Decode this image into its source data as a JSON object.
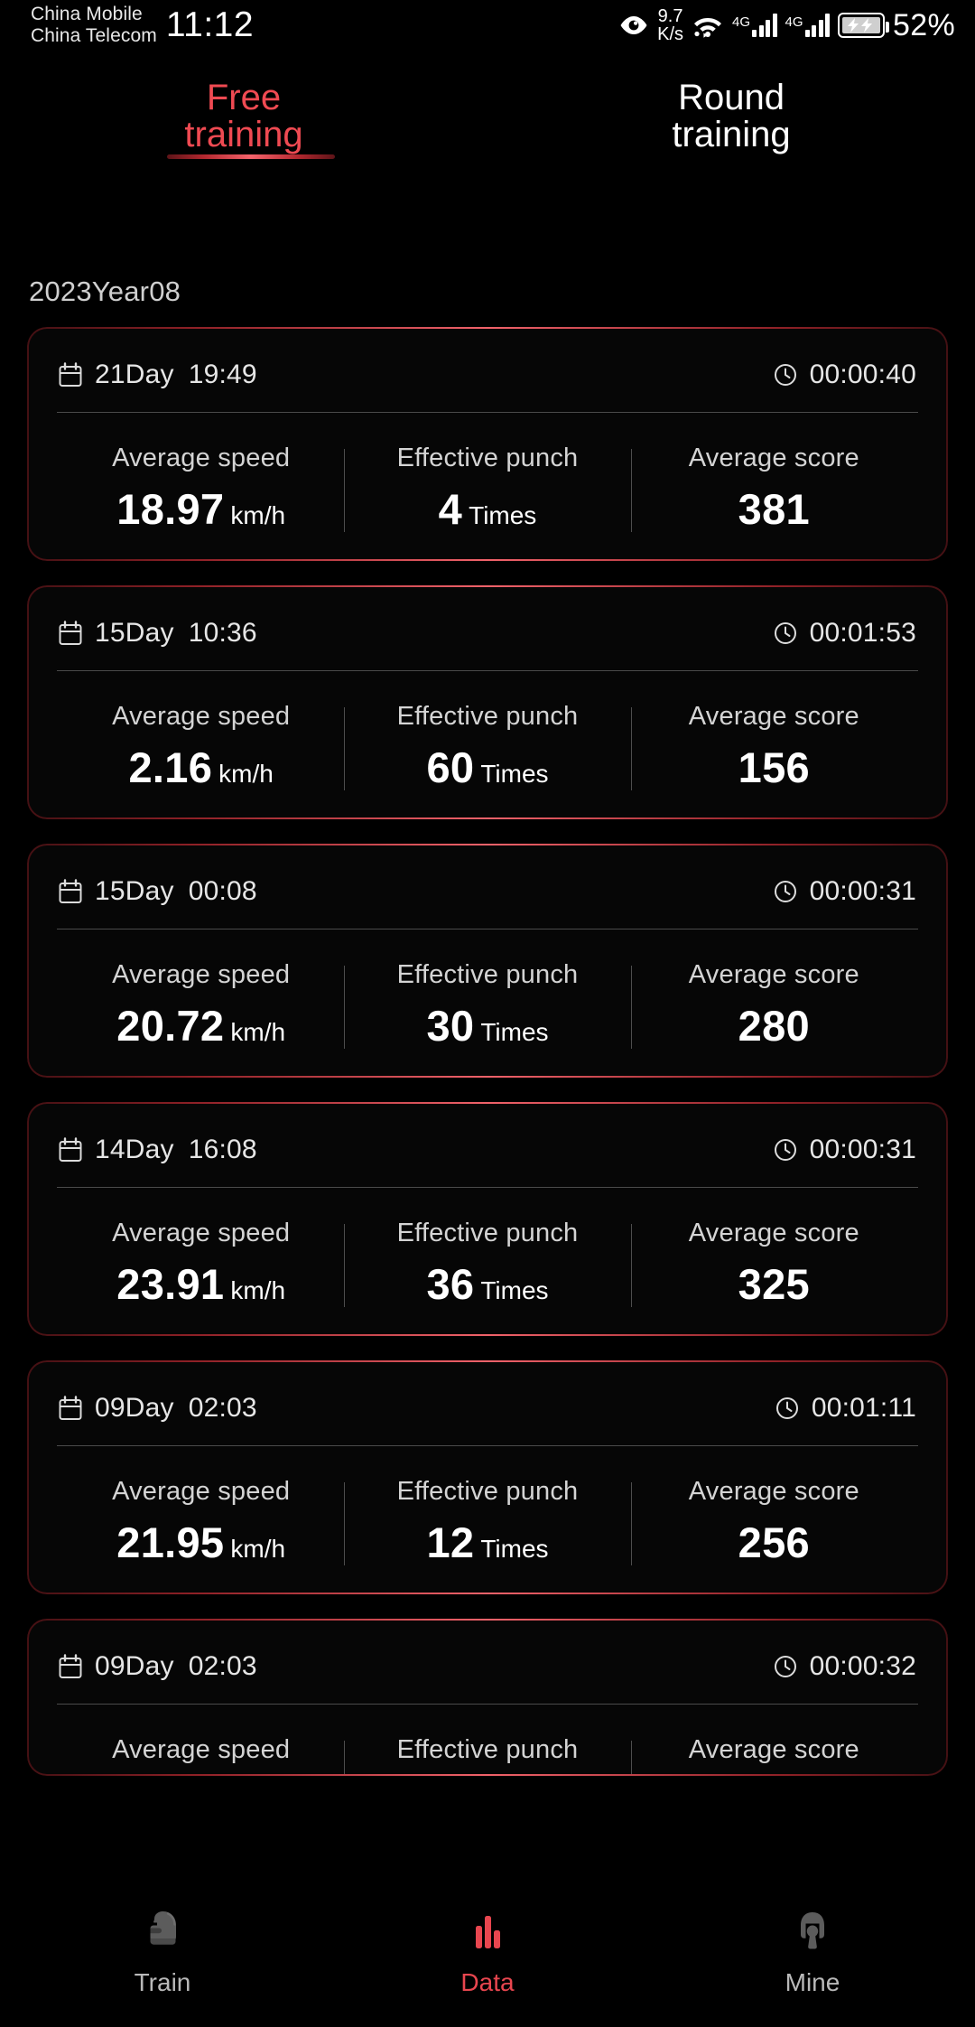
{
  "status_bar": {
    "carrier_primary": "China Mobile",
    "carrier_secondary": "China Telecom",
    "time": "11:12",
    "net_speed_value": "9.7",
    "net_speed_unit": "K/s",
    "network_type_1": "4G",
    "network_type_2": "4G",
    "battery_percent": "52%",
    "icons": [
      "eye-icon",
      "wifi-icon",
      "signal-icon",
      "battery-charging-icon"
    ]
  },
  "tabs": [
    {
      "label_line1": "Free",
      "label_line2": "training",
      "active": true
    },
    {
      "label_line1": "Round",
      "label_line2": "training",
      "active": false
    }
  ],
  "month_header": "2023Year08",
  "stat_labels": {
    "speed": "Average speed",
    "punch": "Effective punch",
    "score": "Average score"
  },
  "units": {
    "speed": "km/h",
    "punch": "Times"
  },
  "sessions": [
    {
      "day": "21Day",
      "time": "19:49",
      "duration": "00:00:40",
      "speed": "18.97",
      "punch": "4",
      "score": "381",
      "clipped": false
    },
    {
      "day": "15Day",
      "time": "10:36",
      "duration": "00:01:53",
      "speed": "2.16",
      "punch": "60",
      "score": "156",
      "clipped": false
    },
    {
      "day": "15Day",
      "time": "00:08",
      "duration": "00:00:31",
      "speed": "20.72",
      "punch": "30",
      "score": "280",
      "clipped": false
    },
    {
      "day": "14Day",
      "time": "16:08",
      "duration": "00:00:31",
      "speed": "23.91",
      "punch": "36",
      "score": "325",
      "clipped": false
    },
    {
      "day": "09Day",
      "time": "02:03",
      "duration": "00:01:11",
      "speed": "21.95",
      "punch": "12",
      "score": "256",
      "clipped": false
    },
    {
      "day": "09Day",
      "time": "02:03",
      "duration": "00:00:32",
      "speed": "",
      "punch": "",
      "score": "",
      "clipped": true
    }
  ],
  "bottom_nav": [
    {
      "label": "Train",
      "icon": "boxing-glove-icon",
      "active": false
    },
    {
      "label": "Data",
      "icon": "bar-chart-icon",
      "active": true
    },
    {
      "label": "Mine",
      "icon": "person-icon",
      "active": false
    }
  ],
  "colors": {
    "accent": "#ef4a52",
    "card_border": "#f0626a",
    "background": "#000000",
    "text_primary": "#ffffff",
    "text_secondary": "#d4d4d4"
  }
}
